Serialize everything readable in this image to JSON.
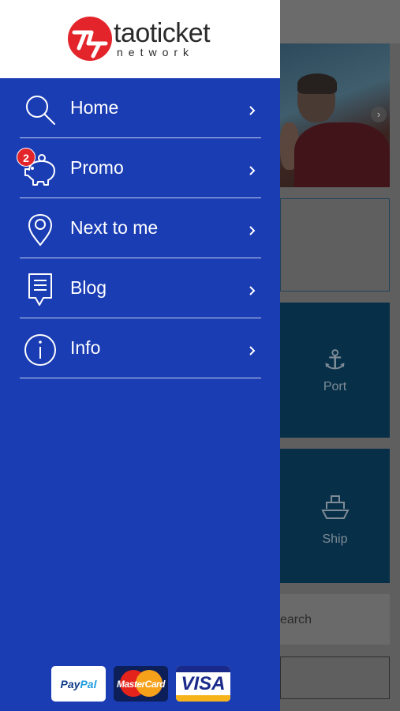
{
  "brand": {
    "name": "taoticket",
    "subtitle": "network",
    "accent": "#e3252b",
    "drawer_color": "#1b3db4"
  },
  "menu": {
    "items": [
      {
        "label": "Home",
        "icon": "search-icon"
      },
      {
        "label": "Promo",
        "icon": "piggy-bank-icon",
        "badge": "2"
      },
      {
        "label": "Next to me",
        "icon": "location-pin-icon"
      },
      {
        "label": "Blog",
        "icon": "blog-document-icon"
      },
      {
        "label": "Info",
        "icon": "info-icon"
      }
    ]
  },
  "payments": {
    "paypal_a": "Pay",
    "paypal_b": "Pal",
    "mastercard": "MasterCard",
    "visa": "VISA"
  },
  "background_page": {
    "tiles": [
      {
        "label": "Port",
        "icon": "anchor-icon"
      },
      {
        "label": "Ship",
        "icon": "ship-icon"
      }
    ],
    "search_fragment": "earch"
  }
}
